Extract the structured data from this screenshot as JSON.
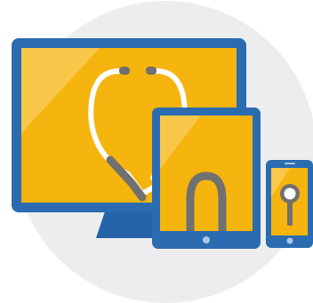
{
  "illustration": {
    "subject": "responsive-devices-health-check",
    "icons": [
      "desktop-monitor-icon",
      "tablet-icon",
      "smartphone-icon",
      "stethoscope-icon",
      "magnifying-glass-icon"
    ],
    "colors": {
      "background_circle": "#ededed",
      "device_frame": "#2b6cb0",
      "device_frame_dark": "#1f5a9a",
      "screen": "#f6b40e",
      "screen_highlight": "#f9c84a",
      "stethoscope_tube": "#ffffff",
      "stethoscope_metal": "#707070",
      "stand": "#2563a8",
      "button": "#a9c6e8"
    }
  }
}
